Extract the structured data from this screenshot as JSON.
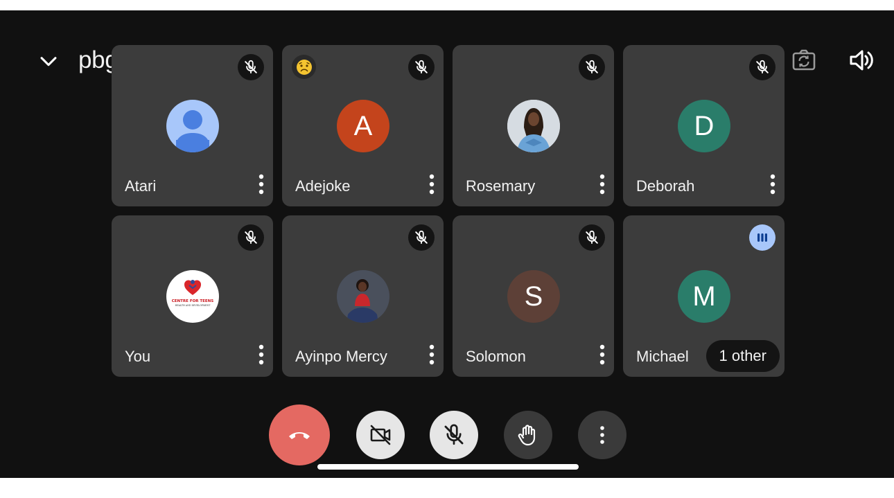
{
  "header": {
    "meeting_code": "pbg-pbzc-ocj"
  },
  "participants": [
    {
      "name": "Atari",
      "avatar_type": "default-person",
      "avatar_color": "#a8c7fa",
      "status": "muted"
    },
    {
      "name": "Adejoke",
      "avatar_letter": "A",
      "avatar_color": "#c4441c",
      "status": "muted",
      "reaction": "sad-face-emoji"
    },
    {
      "name": "Rosemary",
      "avatar_type": "photo",
      "status": "muted"
    },
    {
      "name": "Deborah",
      "avatar_letter": "D",
      "avatar_color": "#2a7d6a",
      "status": "muted"
    },
    {
      "name": "You",
      "avatar_type": "logo",
      "logo_text_1": "CENTRE FOR TEENS",
      "logo_text_2": "HEALTH AND DEVELOPMENT",
      "status": "muted"
    },
    {
      "name": "Ayinpo Mercy",
      "avatar_type": "photo",
      "status": "muted"
    },
    {
      "name": "Solomon",
      "avatar_letter": "S",
      "avatar_color": "#5d4037",
      "status": "muted"
    },
    {
      "name": "Michael",
      "avatar_letter": "M",
      "avatar_color": "#2a7d6a",
      "status": "speaking",
      "extra_label": "1 other"
    }
  ],
  "controls": {
    "end_call_color": "#e46962",
    "camera": "camera-off-icon",
    "mic": "mic-off-icon",
    "hand": "raise-hand-icon",
    "more": "more-vertical-icon"
  }
}
